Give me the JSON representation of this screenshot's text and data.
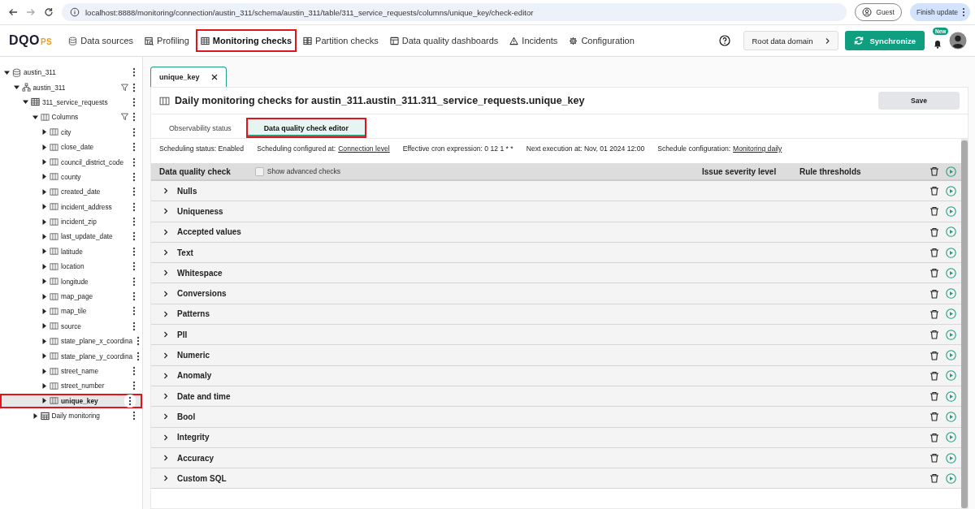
{
  "browser": {
    "url": "localhost:8888/monitoring/connection/austin_311/schema/austin_311/table/311_service_requests/columns/unique_key/check-editor",
    "profile": "Guest",
    "update_button": "Finish update"
  },
  "header": {
    "logo": {
      "main": "DQO",
      "suffix": "PS"
    },
    "nav": [
      {
        "label": "Data sources",
        "kind": "database",
        "selected": false,
        "highlighted": false
      },
      {
        "label": "Profiling",
        "kind": "profiling",
        "selected": false,
        "highlighted": false
      },
      {
        "label": "Monitoring checks",
        "kind": "table",
        "selected": true,
        "highlighted": true
      },
      {
        "label": "Partition checks",
        "kind": "partition",
        "selected": false,
        "highlighted": false
      },
      {
        "label": "Data quality dashboards",
        "kind": "dashboard",
        "selected": false,
        "highlighted": false
      },
      {
        "label": "Incidents",
        "kind": "warning",
        "selected": false,
        "highlighted": false
      },
      {
        "label": "Configuration",
        "kind": "gear",
        "selected": false,
        "highlighted": false
      }
    ],
    "domain_button": "Root data domain",
    "sync_button": "Synchronize",
    "notification_badge": "New"
  },
  "tree": [
    {
      "label": "austin_311",
      "kind": "database",
      "expanded": true,
      "filter": false,
      "selected": false,
      "highlighted": false,
      "children": [
        {
          "label": "austin_311",
          "kind": "schema",
          "expanded": true,
          "filter": true,
          "selected": false,
          "highlighted": false,
          "children": [
            {
              "label": "311_service_requests",
              "kind": "table",
              "expanded": true,
              "filter": false,
              "selected": false,
              "highlighted": false,
              "children": [
                {
                  "label": "Columns",
                  "kind": "column",
                  "expanded": true,
                  "filter": true,
                  "selected": false,
                  "highlighted": false,
                  "children": [
                    {
                      "label": "city",
                      "kind": "column",
                      "expanded": false,
                      "filter": false,
                      "selected": false,
                      "highlighted": false
                    },
                    {
                      "label": "close_date",
                      "kind": "column",
                      "expanded": false,
                      "filter": false,
                      "selected": false,
                      "highlighted": false
                    },
                    {
                      "label": "council_district_code",
                      "kind": "column",
                      "expanded": false,
                      "filter": false,
                      "selected": false,
                      "highlighted": false
                    },
                    {
                      "label": "county",
                      "kind": "column",
                      "expanded": false,
                      "filter": false,
                      "selected": false,
                      "highlighted": false
                    },
                    {
                      "label": "created_date",
                      "kind": "column",
                      "expanded": false,
                      "filter": false,
                      "selected": false,
                      "highlighted": false
                    },
                    {
                      "label": "incident_address",
                      "kind": "column",
                      "expanded": false,
                      "filter": false,
                      "selected": false,
                      "highlighted": false
                    },
                    {
                      "label": "incident_zip",
                      "kind": "column",
                      "expanded": false,
                      "filter": false,
                      "selected": false,
                      "highlighted": false
                    },
                    {
                      "label": "last_update_date",
                      "kind": "column",
                      "expanded": false,
                      "filter": false,
                      "selected": false,
                      "highlighted": false
                    },
                    {
                      "label": "latitude",
                      "kind": "column",
                      "expanded": false,
                      "filter": false,
                      "selected": false,
                      "highlighted": false
                    },
                    {
                      "label": "location",
                      "kind": "column",
                      "expanded": false,
                      "filter": false,
                      "selected": false,
                      "highlighted": false
                    },
                    {
                      "label": "longitude",
                      "kind": "column",
                      "expanded": false,
                      "filter": false,
                      "selected": false,
                      "highlighted": false
                    },
                    {
                      "label": "map_page",
                      "kind": "column",
                      "expanded": false,
                      "filter": false,
                      "selected": false,
                      "highlighted": false
                    },
                    {
                      "label": "map_tile",
                      "kind": "column",
                      "expanded": false,
                      "filter": false,
                      "selected": false,
                      "highlighted": false
                    },
                    {
                      "label": "source",
                      "kind": "column",
                      "expanded": false,
                      "filter": false,
                      "selected": false,
                      "highlighted": false
                    },
                    {
                      "label": "state_plane_x_coordina",
                      "kind": "column",
                      "expanded": false,
                      "filter": false,
                      "selected": false,
                      "highlighted": false
                    },
                    {
                      "label": "state_plane_y_coordina",
                      "kind": "column",
                      "expanded": false,
                      "filter": false,
                      "selected": false,
                      "highlighted": false
                    },
                    {
                      "label": "street_name",
                      "kind": "column",
                      "expanded": false,
                      "filter": false,
                      "selected": false,
                      "highlighted": false
                    },
                    {
                      "label": "street_number",
                      "kind": "column",
                      "expanded": false,
                      "filter": false,
                      "selected": false,
                      "highlighted": false
                    },
                    {
                      "label": "unique_key",
                      "kind": "column",
                      "expanded": false,
                      "filter": false,
                      "selected": true,
                      "highlighted": true
                    }
                  ]
                },
                {
                  "label": "Daily monitoring",
                  "kind": "calendar",
                  "expanded": false,
                  "filter": false,
                  "selected": false,
                  "highlighted": false
                }
              ]
            }
          ]
        }
      ]
    }
  ],
  "editor": {
    "tab": {
      "label": "unique_key"
    },
    "title": "Daily monitoring checks for austin_311.austin_311.311_service_requests.unique_key",
    "save_button": "Save",
    "subtabs": [
      {
        "label": "Observability status",
        "selected": false,
        "highlighted": false
      },
      {
        "label": "Data quality check editor",
        "selected": true,
        "highlighted": true
      }
    ],
    "schedule": [
      {
        "kind": "text",
        "label": "Scheduling status: Enabled"
      },
      {
        "kind": "link",
        "label": "Scheduling configured at:",
        "value": "Connection level"
      },
      {
        "kind": "text",
        "label": "Effective cron expression: 0 12 1 * *"
      },
      {
        "kind": "text",
        "label": "Next execution at: Nov, 01 2024 12:00"
      },
      {
        "kind": "link",
        "label": "Schedule configuration:",
        "value": "Monitoring daily"
      }
    ],
    "table": {
      "columns": [
        "Data quality check",
        "Issue severity level",
        "Rule thresholds"
      ],
      "advanced_checks": {
        "label": "Show advanced checks",
        "checked": false
      },
      "rows": [
        {
          "label": "Nulls",
          "expanded": false
        },
        {
          "label": "Uniqueness",
          "expanded": false
        },
        {
          "label": "Accepted values",
          "expanded": false
        },
        {
          "label": "Text",
          "expanded": false
        },
        {
          "label": "Whitespace",
          "expanded": false
        },
        {
          "label": "Conversions",
          "expanded": false
        },
        {
          "label": "Patterns",
          "expanded": false
        },
        {
          "label": "PII",
          "expanded": false
        },
        {
          "label": "Numeric",
          "expanded": false
        },
        {
          "label": "Anomaly",
          "expanded": false
        },
        {
          "label": "Date and time",
          "expanded": false
        },
        {
          "label": "Bool",
          "expanded": false
        },
        {
          "label": "Integrity",
          "expanded": false
        },
        {
          "label": "Accuracy",
          "expanded": false
        },
        {
          "label": "Custom SQL",
          "expanded": false
        }
      ]
    }
  }
}
